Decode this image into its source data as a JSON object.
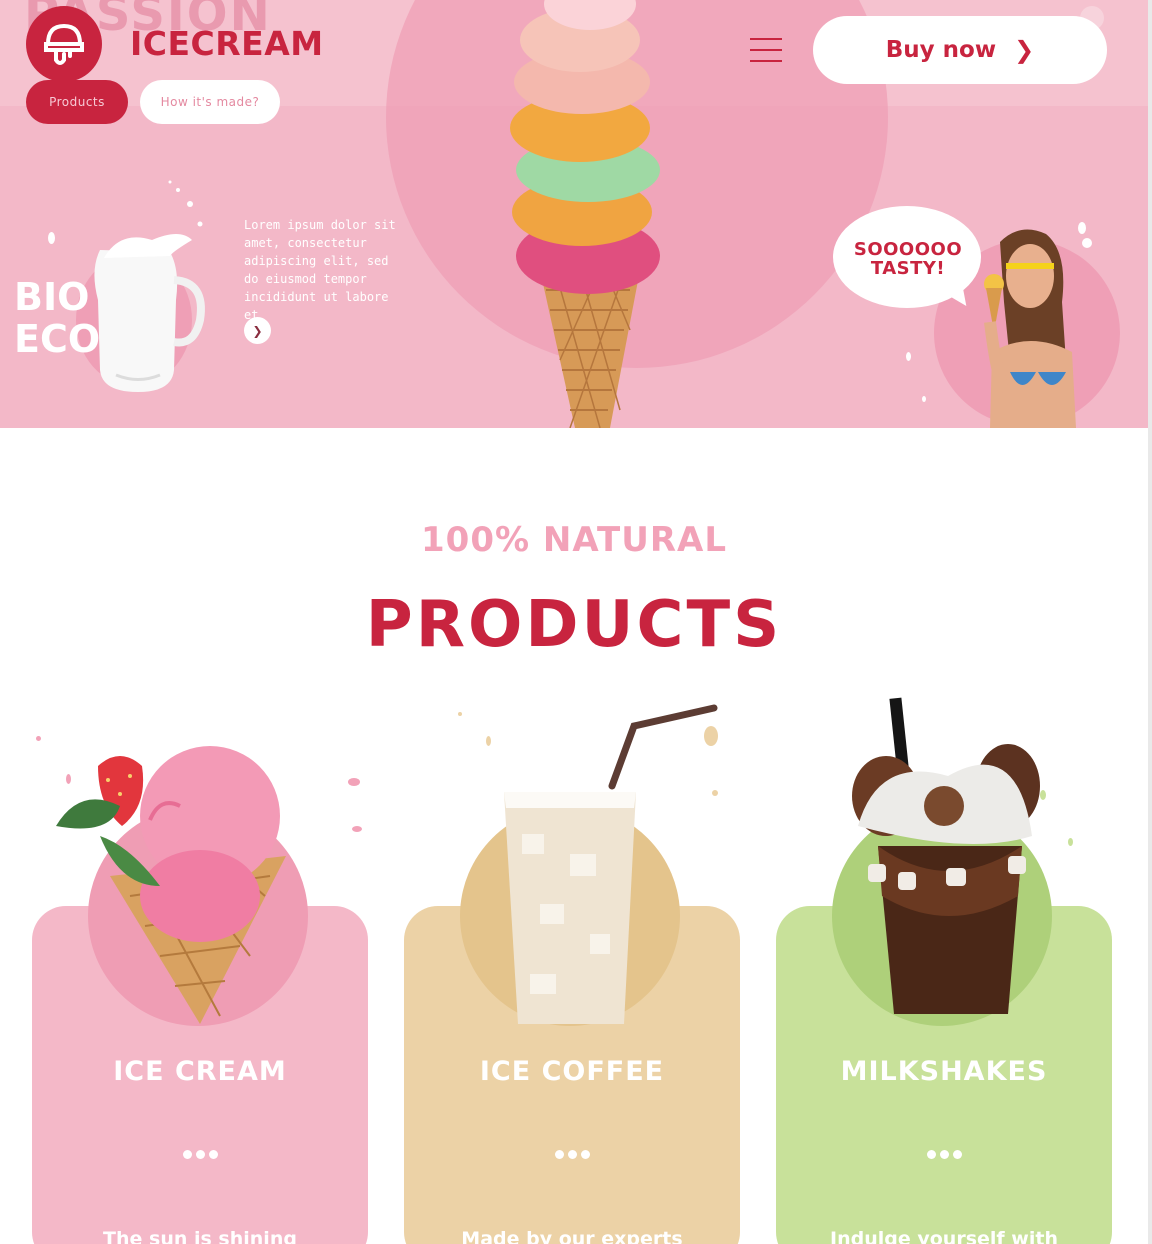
{
  "hero": {
    "background_word": "PASSION",
    "brand": "ICECREAM",
    "nav_pills": [
      {
        "label": "Products",
        "active": true
      },
      {
        "label": "How it's made?",
        "active": false
      }
    ],
    "buy_button": {
      "label": "Buy now",
      "icon": "chevron-right-icon"
    },
    "menu_icon": "hamburger-menu-icon",
    "bio_eco_text": [
      "BIO",
      "ECO"
    ],
    "copy": "Lorem ipsum dolor sit amet, consectetur adipiscing elit, sed do eiusmod tempor incididunt ut labore et",
    "arrow_icon": "chevron-right-icon",
    "speech_bubble": [
      "SOOOOOO",
      "TASTY!"
    ]
  },
  "products": {
    "eyebrow": "100% NATURAL",
    "heading": "PRODUCTS",
    "cards": [
      {
        "title": "ICE CREAM",
        "description": "The sun is shining",
        "color": "#f4b8c8",
        "circle_color": "#ef9db4"
      },
      {
        "title": "ICE COFFEE",
        "description": "Made by our experts",
        "color": "#ecd2a6",
        "circle_color": "#e4c48c"
      },
      {
        "title": "MILKSHAKES",
        "description": "Indulge yourself with",
        "color": "#c8e19a",
        "circle_color": "#aed07a"
      }
    ]
  },
  "colors": {
    "brand_red": "#c8243f",
    "hero_pink": "#f3b8c8",
    "accent_pink": "#f2a2b8"
  }
}
